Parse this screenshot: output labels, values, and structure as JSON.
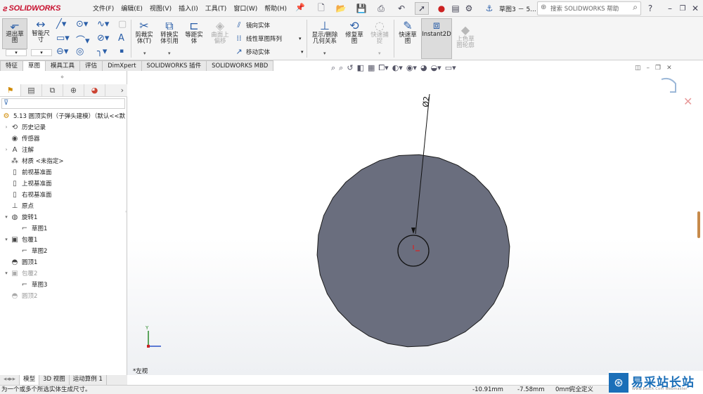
{
  "app": {
    "brand": "SOLIDWORKS",
    "doc_title": "草图3 － 5..."
  },
  "menu": [
    "文件(F)",
    "编辑(E)",
    "视图(V)",
    "插入(I)",
    "工具(T)",
    "窗口(W)",
    "帮助(H)"
  ],
  "search": {
    "placeholder": "搜索 SOLIDWORKS 帮助"
  },
  "commands": {
    "exit_sketch": "退出草图",
    "smart_dim": "智能尺寸",
    "trim": "剪裁实体(T)",
    "convert": "转换实体引用",
    "offset": "等距实体",
    "offset_surface": "曲面上偏移",
    "mirror": "镜向实体",
    "linear_pattern": "线性草图阵列",
    "move": "移动实体",
    "show_delete": "显示/删除几何关系",
    "repair": "修复草图",
    "quick_snap": "快速捕捉",
    "rapid_sketch": "快速草图",
    "instant2d": "Instant2D",
    "shaded": "上色草图轮廓"
  },
  "tabs": [
    "特征",
    "草图",
    "模具工具",
    "评估",
    "DimXpert",
    "SOLIDWORKS 插件",
    "SOLIDWORKS MBD"
  ],
  "active_tab": "草图",
  "tree": {
    "root": "5.13 圆顶实例（子弹头建模）（默认<<默",
    "items": [
      {
        "label": "历史记录",
        "indent": 1,
        "expandable": true,
        "icon": "history-icon"
      },
      {
        "label": "传感器",
        "indent": 1,
        "expandable": false,
        "icon": "sensor-icon"
      },
      {
        "label": "注解",
        "indent": 1,
        "expandable": true,
        "icon": "annotation-icon"
      },
      {
        "label": "材质 <未指定>",
        "indent": 1,
        "expandable": false,
        "icon": "material-icon"
      },
      {
        "label": "前视基准面",
        "indent": 1,
        "expandable": false,
        "icon": "plane-icon"
      },
      {
        "label": "上视基准面",
        "indent": 1,
        "expandable": false,
        "icon": "plane-icon"
      },
      {
        "label": "右视基准面",
        "indent": 1,
        "expandable": false,
        "icon": "plane-icon"
      },
      {
        "label": "原点",
        "indent": 1,
        "expandable": false,
        "icon": "origin-icon"
      },
      {
        "label": "旋转1",
        "indent": 1,
        "expandable": true,
        "icon": "revolve-icon"
      },
      {
        "label": "草图1",
        "indent": 2,
        "expandable": false,
        "icon": "sketch-icon"
      },
      {
        "label": "包覆1",
        "indent": 1,
        "expandable": true,
        "icon": "wrap-icon"
      },
      {
        "label": "草图2",
        "indent": 2,
        "expandable": false,
        "icon": "sketch-icon"
      },
      {
        "label": "圆顶1",
        "indent": 1,
        "expandable": false,
        "icon": "dome-icon"
      },
      {
        "label": "包覆2",
        "indent": 1,
        "expandable": true,
        "icon": "wrap-icon",
        "dim": true
      },
      {
        "label": "草图3",
        "indent": 2,
        "expandable": false,
        "icon": "sketch-icon"
      },
      {
        "label": "圆顶2",
        "indent": 1,
        "expandable": false,
        "icon": "dome-icon",
        "dim": true
      }
    ]
  },
  "viewport": {
    "dimension": "Ø2",
    "view_label": "*左视",
    "axis_x": "Z",
    "axis_y": "Y",
    "fill_color": "#6a6e7e"
  },
  "bottom_tabs": [
    "模型",
    "3D 视图",
    "运动算例 1"
  ],
  "status": {
    "message": "为一个或多个所选实体生成尺寸。",
    "x": "-10.91mm",
    "y": "-7.58mm",
    "z": "0mm",
    "state": "完全定义"
  },
  "watermark": {
    "text": "易采站长站",
    "sub": "Www.Easck.Com  Webmaster"
  }
}
